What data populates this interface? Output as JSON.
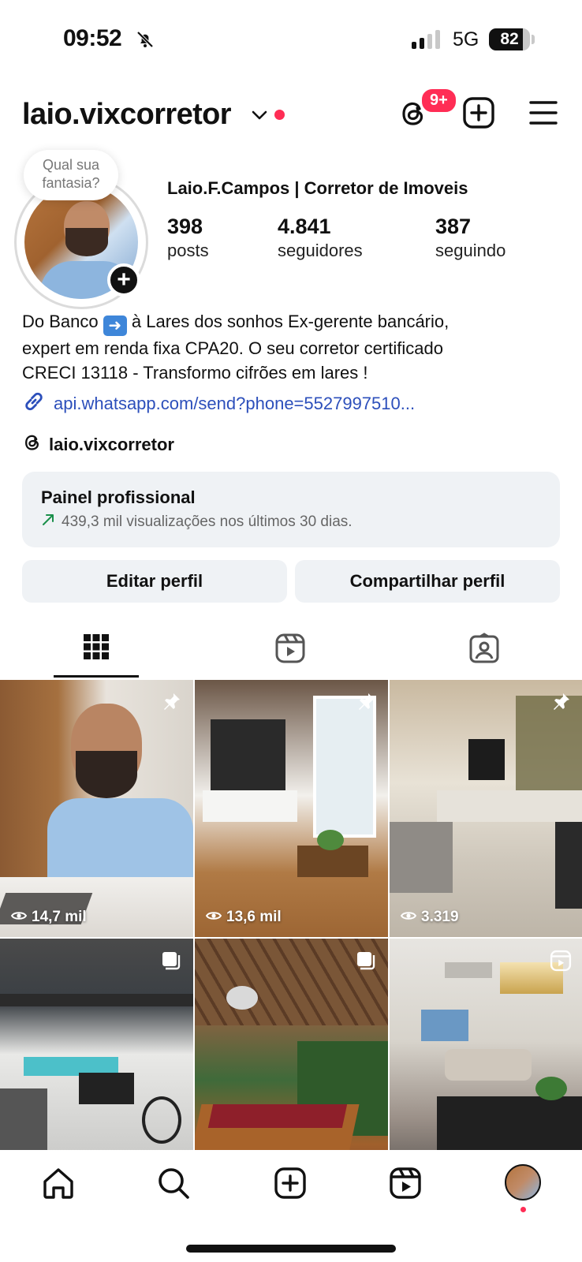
{
  "status_bar": {
    "time": "09:52",
    "network": "5G",
    "battery": "82",
    "battery_level": 0.82
  },
  "header": {
    "username": "laio.vixcorretor",
    "notification_badge": "9+"
  },
  "profile": {
    "avatar_bubble": "Qual sua fantasia?",
    "display_name": "Laio.F.Campos | Corretor de Imoveis",
    "stats": {
      "posts": {
        "value": "398",
        "label": "posts"
      },
      "followers": {
        "value": "4.841",
        "label": "seguidores"
      },
      "following": {
        "value": "387",
        "label": "seguindo"
      }
    },
    "bio": {
      "line1_before": "Do Banco",
      "line1_after": "à Lares dos sonhos Ex-gerente bancário,",
      "line2": "expert em renda fixa CPA20. O seu corretor certificado",
      "line3": "CRECI 13118 - Transformo cifrões em lares !"
    },
    "link": "api.whatsapp.com/send?phone=5527997510...",
    "threads_handle": "laio.vixcorretor"
  },
  "professional_panel": {
    "title": "Painel profissional",
    "subtitle": "439,3 mil visualizações nos últimos 30 dias."
  },
  "buttons": {
    "edit": "Editar perfil",
    "share": "Compartilhar perfil"
  },
  "tabs": [
    "posts-grid",
    "reels",
    "tagged"
  ],
  "grid": [
    {
      "views": "14,7 mil",
      "badge": "pin-icon"
    },
    {
      "views": "13,6 mil",
      "badge": "pin-icon"
    },
    {
      "views": "3.319",
      "badge": "pin-icon"
    },
    {
      "views": "",
      "badge": "carousel-icon"
    },
    {
      "views": "",
      "badge": "carousel-icon"
    },
    {
      "views": "",
      "badge": "reel-icon"
    }
  ],
  "colors": {
    "accent_red": "#ff2d55",
    "link_blue": "#2c4fbb",
    "panel_bg": "#eff2f5"
  }
}
